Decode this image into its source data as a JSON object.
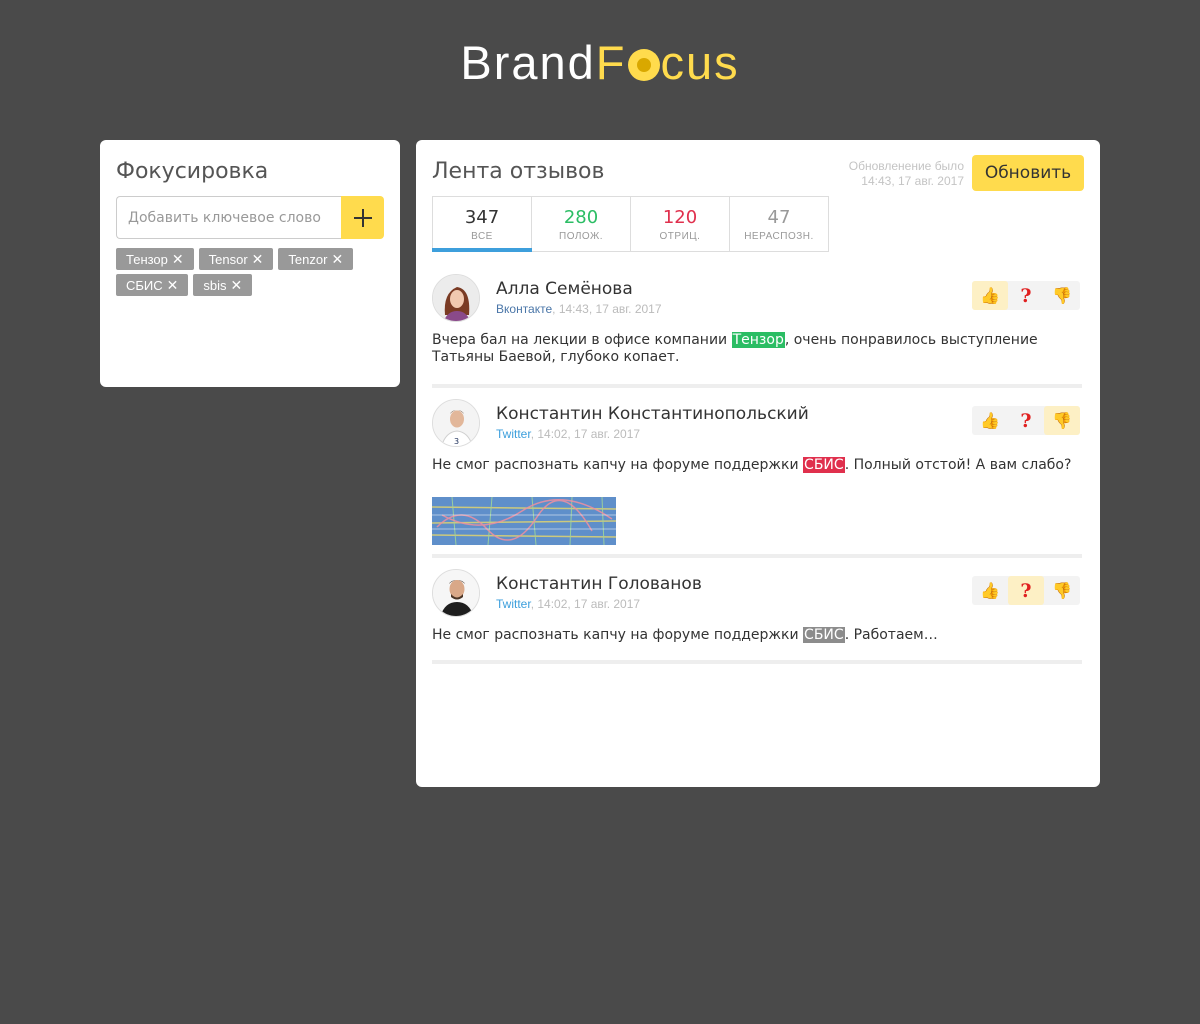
{
  "logo": {
    "brand": "Brand",
    "focus_pre": "F",
    "focus_post": "cus"
  },
  "colors": {
    "accent": "#ffdb4d",
    "positive": "#2bbd64",
    "negative": "#e0304d",
    "neutral": "#8c8c8c",
    "tab_active": "#3d9fdc",
    "background": "#4a4a4a"
  },
  "left": {
    "title": "Фокусировка",
    "input_placeholder": "Добавить ключевое слово",
    "add_icon": "plus-icon",
    "tags": [
      {
        "label": "Тензор"
      },
      {
        "label": "Tensor"
      },
      {
        "label": "Tenzor"
      },
      {
        "label": "СБИС"
      },
      {
        "label": "sbis"
      }
    ]
  },
  "feed": {
    "title": "Лента отзывов",
    "update_note_line1": "Обновленение было",
    "update_note_line2": "14:43, 17 авг. 2017",
    "update_button": "Обновить",
    "tabs": [
      {
        "count": "347",
        "label": "ВСЕ",
        "color": "#333333",
        "active": true
      },
      {
        "count": "280",
        "label": "ПОЛОЖ.",
        "color": "#2bbd64",
        "active": false
      },
      {
        "count": "120",
        "label": "ОТРИЦ.",
        "color": "#e0304d",
        "active": false
      },
      {
        "count": "47",
        "label": "НЕРАСПОЗН.",
        "color": "#999999",
        "active": false
      }
    ],
    "reviews": [
      {
        "name": "Алла Семёнова",
        "source": "Вконтакте",
        "time": ", 14:43, 17 авг. 2017",
        "text_before": "Вчера бал на лекции в офисе компании ",
        "keyword": "Тензор",
        "text_after": ", очень понравилось выступление Татьяны Баевой, глубоко копает.",
        "sentiment": "positive",
        "vote_selected": "like"
      },
      {
        "name": "Константин Константинопольский",
        "source": "Twitter",
        "time": ", 14:02, 17 авг. 2017",
        "text_before": "Не смог распознать капчу на форуме поддержки ",
        "keyword": "СБИС",
        "text_after": ". Полный отстой! А вам слабо?",
        "sentiment": "negative",
        "vote_selected": "dislike"
      },
      {
        "name": "Константин Голованов",
        "source": "Twitter",
        "time": ", 14:02, 17 авг. 2017",
        "text_before": "Не смог распознать капчу на форуме поддержки ",
        "keyword": "СБИС",
        "text_after": ". Работаем…",
        "sentiment": "neutral",
        "vote_selected": "unknown"
      }
    ],
    "vote_icons": {
      "like": "👍",
      "unknown": "?",
      "dislike": "👎"
    }
  }
}
